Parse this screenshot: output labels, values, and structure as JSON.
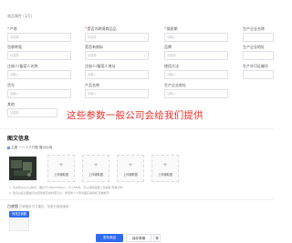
{
  "section_top_label": "商品属性 (1/1)",
  "fields": [
    {
      "label": "产地",
      "required": true,
      "placeholder": "请选择",
      "has_caret": true
    },
    {
      "label": "是否为跨境商品品",
      "required": true,
      "placeholder": "请选择",
      "has_caret": true
    },
    {
      "label": "保质期",
      "required": true,
      "placeholder": "请输入",
      "has_caret": false
    },
    {
      "label": "生产企业名称",
      "required": false,
      "placeholder": "",
      "has_caret": false
    },
    {
      "label": "包装种类",
      "required": false,
      "placeholder": "请选择",
      "has_caret": true
    },
    {
      "label": "是否有商标",
      "required": false,
      "placeholder": "请选择",
      "has_caret": true
    },
    {
      "label": "品牌",
      "required": false,
      "placeholder": "请选择",
      "has_caret": true
    },
    {
      "label": "生产企业地址",
      "required": false,
      "placeholder": "",
      "has_caret": false
    },
    {
      "label": "注册人/备案人名称",
      "required": false,
      "placeholder": "请输入",
      "has_caret": false
    },
    {
      "label": "注册人/备案人地址",
      "required": false,
      "placeholder": "请输入",
      "has_caret": false
    },
    {
      "label": "使用方法",
      "required": false,
      "placeholder": "请输入",
      "has_caret": false
    },
    {
      "label": "生产许可证编号",
      "required": false,
      "placeholder": "",
      "has_caret": false
    },
    {
      "label": "货号",
      "required": false,
      "placeholder": "请输入",
      "has_caret": false
    },
    {
      "label": "产品名称",
      "required": false,
      "placeholder": "请输入",
      "has_caret": false
    },
    {
      "label": "生产企业地址",
      "required": false,
      "placeholder": "请输入",
      "has_caret": false
    },
    {
      "label": "其他",
      "required": false,
      "placeholder": "请选择",
      "has_caret": true
    }
  ],
  "notice_text": "这些参数一般公司会给我们提供",
  "image_section": {
    "title": "图文信息",
    "radio_label": "主图 一一 1个方图 展示比例",
    "upload_label": "上传辅助图",
    "tips": [
      "1. 仅支持jpg,png格式，图片尺寸800*800px，大小5M内，可以使用截图工具截取 查看示例",
      "2. 建议白底主图由平台自动规范素材库可以，搜索整个人申请图获得授权 查看规范"
    ],
    "tip_link": "查看示例"
  },
  "detail_section": {
    "title": "白底图",
    "hint": "白底图片尺寸建议，仅部分商品使用",
    "tag_label": "商品正面图"
  },
  "buttons": {
    "publish": "发布商品",
    "save_draft": "保存草稿",
    "extra_icon": "⧉"
  }
}
